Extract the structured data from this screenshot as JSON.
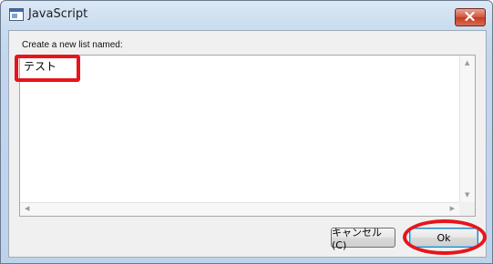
{
  "window": {
    "title": "JavaScript"
  },
  "dialog": {
    "prompt_label": "Create a new list named:",
    "input_value": "テスト"
  },
  "buttons": {
    "cancel_label": "キャンセル(C)",
    "ok_label": "Ok"
  },
  "icons": {
    "app": "window-icon",
    "close": "close-icon",
    "scroll_up": "scroll-up-arrow-icon",
    "scroll_down": "scroll-down-arrow-icon",
    "scroll_left": "scroll-left-arrow-icon",
    "scroll_right": "scroll-right-arrow-icon"
  },
  "colors": {
    "highlight": "#e8141c",
    "close_button": "#c23b22",
    "default_button_border": "#3c7fb1"
  }
}
